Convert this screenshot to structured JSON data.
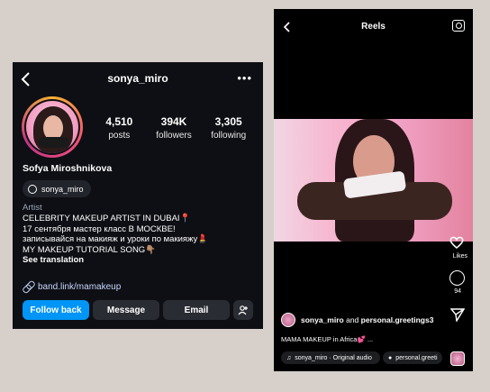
{
  "profile": {
    "username": "sonya_miro",
    "stats": [
      {
        "value": "4,510",
        "label": "posts"
      },
      {
        "value": "394K",
        "label": "followers"
      },
      {
        "value": "3,305",
        "label": "following"
      }
    ],
    "full_name": "Sofya Miroshnikova",
    "threads_handle": "sonya_miro",
    "category": "Artist",
    "bio_lines": [
      "CELEBRITY MAKEUP ARTIST IN DUBAI📍",
      "17 сентября мастер класс В МОСКВЕ!",
      "записывайся на макияж и уроки по макияжу💄",
      "MY MAKEUP TUTORIAL SONG👇🏽"
    ],
    "see_translation": "See translation",
    "link": "band.link/mamakeup",
    "buttons": {
      "follow": "Follow back",
      "message": "Message",
      "email": "Email"
    }
  },
  "reels": {
    "title": "Reels",
    "likes_label": "Likes",
    "comment_count": "94",
    "user": "sonya_miro",
    "and_text": "and",
    "collab": "personal.greetings3",
    "caption": "MAMA MAKEUP in Africa💕 ...",
    "audio": "sonya_miro · Original audio",
    "audio_tag": "personal.greeti"
  },
  "icons": [
    "back-chevron-icon",
    "more-icon",
    "threads-icon",
    "link-icon",
    "add-person-icon",
    "camera-icon",
    "heart-icon",
    "comment-icon",
    "share-icon",
    "music-icon",
    "person-icon"
  ]
}
